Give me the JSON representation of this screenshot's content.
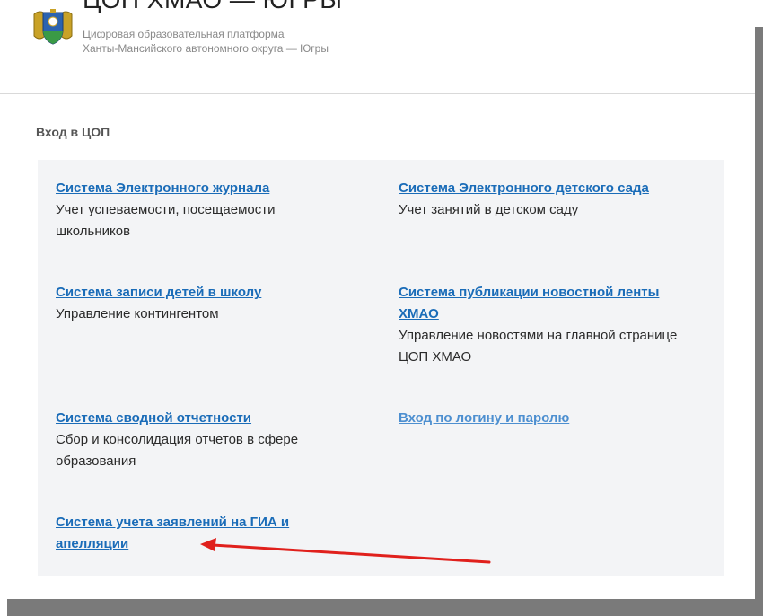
{
  "header": {
    "title": "ЦОП ХМАО — ЮГРЫ",
    "subtitle_line1": "Цифровая образовательная платформа",
    "subtitle_line2": "Ханты-Мансийского автономного округа — Югры"
  },
  "section": {
    "title": "Вход в ЦОП"
  },
  "systems": [
    {
      "link": "Система Электронного журнала",
      "description": "Учет успеваемости, посещаемости школьников"
    },
    {
      "link": "Система Электронного детского сада",
      "description": "Учет занятий в детском саду"
    },
    {
      "link": "Система записи детей в школу",
      "description": "Управление контингентом"
    },
    {
      "link": "Система публикации новостной ленты ХМАО",
      "description": "Управление новостями на главной странице ЦОП ХМАО"
    },
    {
      "link": "Система сводной отчетности",
      "description": "Сбор и консолидация отчетов в сфере образования"
    },
    {
      "link": "Вход по логину и паролю",
      "description": ""
    },
    {
      "link": "Система учета заявлений на ГИА и апелляции",
      "description": ""
    }
  ],
  "colors": {
    "link": "#1a6cb8",
    "link_secondary": "#4d8fd0",
    "panel_bg": "#f3f4f6",
    "annotation_arrow": "#e0201c"
  },
  "icons": {
    "logo": "coat-of-arms-icon",
    "annotation": "red-arrow-annotation"
  }
}
